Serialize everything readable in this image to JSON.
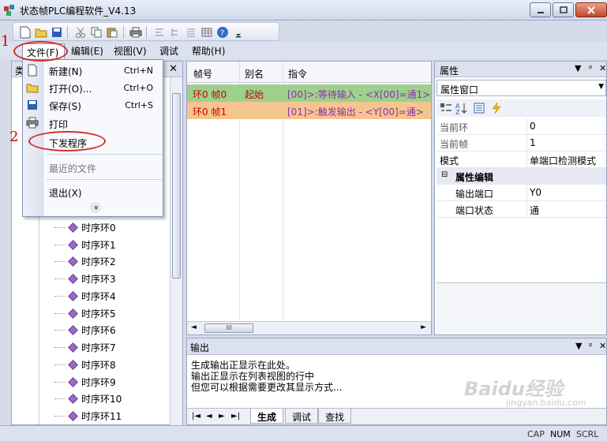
{
  "window": {
    "title": "状态帧PLC编程软件_V4.13"
  },
  "menubar": {
    "items": [
      "文件(F)",
      "编辑(E)",
      "视图(V)",
      "调试",
      "帮助(H)"
    ]
  },
  "file_menu": {
    "new_label": "新建(N)",
    "new_shortcut": "Ctrl+N",
    "open_label": "打开(O)...",
    "open_shortcut": "Ctrl+O",
    "save_label": "保存(S)",
    "save_shortcut": "Ctrl+S",
    "print_label": "打印",
    "download_label": "下发程序",
    "recent_label": "最近的文件",
    "exit_label": "退出(X)",
    "more_glyph": "»"
  },
  "left_panel": {
    "header_char": "类",
    "close_glyph": "✕",
    "tree_items": [
      "时序环0",
      "时序环1",
      "时序环2",
      "时序环3",
      "时序环4",
      "时序环5",
      "时序环6",
      "时序环7",
      "时序环8",
      "时序环9",
      "时序环10",
      "时序环11"
    ]
  },
  "grid": {
    "headers": [
      "帧号",
      "别名",
      "指令"
    ],
    "rows": [
      {
        "frame": "环0 帧0",
        "alias": "起始",
        "cmd": "[00]>:等待输入 - <X[00]=通1>"
      },
      {
        "frame": "环0 帧1",
        "alias": "",
        "cmd": "[01]>:触发输出 - <Y[00]=通>"
      }
    ],
    "scroll_label": "III"
  },
  "properties": {
    "title": "属性",
    "combo_value": "属性窗口",
    "rows": [
      {
        "key": "当前环",
        "value": "0"
      },
      {
        "key": "当前帧",
        "value": "1"
      },
      {
        "key": "模式",
        "value": "单端口检测模式"
      }
    ],
    "category": "属性编辑",
    "sub_rows": [
      {
        "key": "输出端口",
        "value": "Y0"
      },
      {
        "key": "端口状态",
        "value": "通"
      }
    ]
  },
  "output": {
    "title": "输出",
    "lines": [
      "生成输出正显示在此处。",
      "输出正显示在列表视图的行中",
      "但您可以根据需要更改其显示方式..."
    ],
    "tabs": [
      "生成",
      "调试",
      "查找"
    ]
  },
  "statusbar": {
    "indicators": [
      "CAP",
      "NUM",
      "SCRL"
    ]
  },
  "annotations": {
    "step1": "1",
    "step2": "2",
    "color": "#d0312d"
  },
  "watermark": {
    "brand": "Baidu经验",
    "url": "jingyan.baidu.com"
  }
}
